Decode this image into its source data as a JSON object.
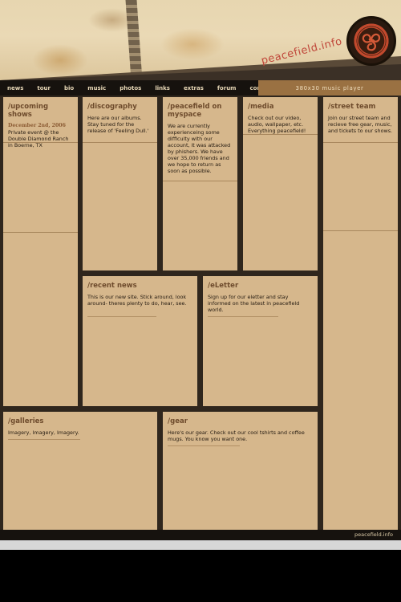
{
  "header": {
    "domain": "peacefield.info"
  },
  "nav": {
    "items": [
      "news",
      "tour",
      "bio",
      "music",
      "photos",
      "links",
      "extras",
      "forum",
      "contact"
    ],
    "player": "380x30 music player"
  },
  "panels": {
    "upcoming": {
      "title": "/upcoming shows",
      "date": "December 2nd, 2006",
      "text": "Private event @ the Double Diamond Ranch in Boerne, TX"
    },
    "discography": {
      "title": "/discography",
      "text": "Here are our albums. Stay tuned for the release of 'Feeling Dull.'"
    },
    "myspace": {
      "title": "/peacefield on myspace",
      "text": "We are currently experienceing some difficulty with our account, it was attacked by phishers. We have over 35,000 friends and we hope to return as soon as possible."
    },
    "media": {
      "title": "/media",
      "text": "Check out our video, audio, wallpaper, etc. Everything peacefield!"
    },
    "street": {
      "title": "/street team",
      "text": "Join our street team and recieve free gear, music, and tickets to our shows."
    },
    "news": {
      "title": "/recent news",
      "text": "This is our new site. Stick around, look around- theres plenty to do, hear, see."
    },
    "eletter": {
      "title": "/eLetter",
      "text": "Sign up for our eletter and stay informed on the latest in peacefield world."
    },
    "galleries": {
      "title": "/galleries",
      "text": "Imagery, Imagery, Imagery."
    },
    "gear": {
      "title": "/gear",
      "text": "Here's our gear. Check out our cool tshirts and coffee mugs. You know you want one."
    }
  },
  "footer": {
    "text": "peacefield.info"
  }
}
